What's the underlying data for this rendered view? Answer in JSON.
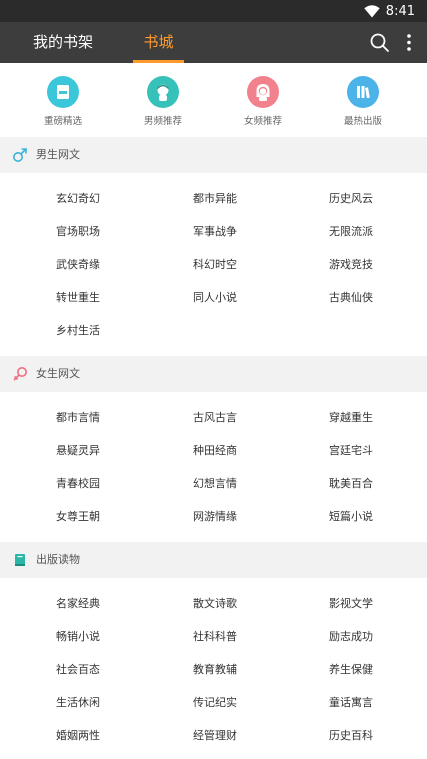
{
  "status": {
    "time": "8:41"
  },
  "nav": {
    "tab_shelf": "我的书架",
    "tab_store": "书城",
    "accent": "#ff9a2e"
  },
  "quick": [
    {
      "label": "重磅精选",
      "icon": "book-cover-icon",
      "color": "#3cc6d9"
    },
    {
      "label": "男频推荐",
      "icon": "boy-avatar-icon",
      "color": "#36c2b8"
    },
    {
      "label": "女频推荐",
      "icon": "girl-avatar-icon",
      "color": "#f2818e"
    },
    {
      "label": "最热出版",
      "icon": "bookshelf-icon",
      "color": "#4cb3e8"
    }
  ],
  "sections": [
    {
      "title": "男生网文",
      "icon": "male-symbol-icon",
      "items": [
        "玄幻奇幻",
        "都市异能",
        "历史风云",
        "官场职场",
        "军事战争",
        "无限流派",
        "武侠奇缘",
        "科幻时空",
        "游戏竞技",
        "转世重生",
        "同人小说",
        "古典仙侠",
        "乡村生活"
      ]
    },
    {
      "title": "女生网文",
      "icon": "female-symbol-icon",
      "items": [
        "都市言情",
        "古风古言",
        "穿越重生",
        "悬疑灵异",
        "种田经商",
        "宫廷宅斗",
        "青春校园",
        "幻想言情",
        "耽美百合",
        "女尊王朝",
        "网游情缘",
        "短篇小说"
      ]
    },
    {
      "title": "出版读物",
      "icon": "book-icon",
      "items": [
        "名家经典",
        "散文诗歌",
        "影视文学",
        "畅销小说",
        "社科科普",
        "励志成功",
        "社会百态",
        "教育教辅",
        "养生保健",
        "生活休闲",
        "传记纪实",
        "童话寓言",
        "婚姻两性",
        "经管理财",
        "历史百科"
      ]
    }
  ]
}
